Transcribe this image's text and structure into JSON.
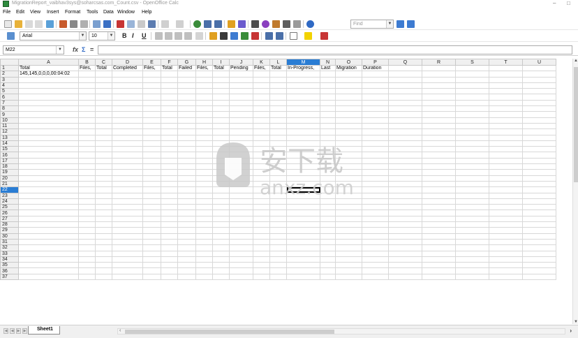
{
  "window": {
    "title": "MigrationReport_vaibhav3sys@soharcsas.com_Count.csv - OpenOffice Calc",
    "minimize": "–",
    "maximize": "□"
  },
  "menu": [
    "File",
    "Edit",
    "View",
    "Insert",
    "Format",
    "Tools",
    "Data",
    "Window",
    "Help"
  ],
  "toolbar": {
    "find_placeholder": "Find",
    "font_name": "Arial",
    "font_size": "10",
    "bold": "B",
    "italic": "I",
    "underline": "U"
  },
  "formula_bar": {
    "cell_ref": "M22",
    "fx": "fx",
    "sum": "Σ",
    "equals": "=",
    "content": ""
  },
  "grid": {
    "columns": [
      "A",
      "B",
      "C",
      "D",
      "E",
      "F",
      "G",
      "H",
      "I",
      "J",
      "K",
      "L",
      "M",
      "N",
      "O",
      "P",
      "Q",
      "R",
      "S",
      "T",
      "U"
    ],
    "selected_column": "M",
    "selected_row": 22,
    "rows": [
      [
        "Total",
        "Files,",
        "Total",
        "Completed",
        "Files,",
        "Total",
        "Failed",
        "Files,",
        "Total",
        "Pending",
        "Files,",
        "Total",
        "In-Progress,",
        "Last",
        "Migration",
        "Duration",
        "",
        "",
        "",
        "",
        ""
      ],
      [
        "145,145,0,0,0,00:04:02",
        "",
        "",
        "",
        "",
        "",
        "",
        "",
        "",
        "",
        "",
        "",
        "",
        "",
        "",
        "",
        "",
        "",
        "",
        "",
        ""
      ]
    ],
    "row_count": 37
  },
  "sheet_tabs": [
    "Sheet1"
  ],
  "watermark": {
    "chinese": "安下载",
    "latin": "anxz.com"
  },
  "colors": {
    "selection": "#2a7dd4",
    "header_bg": "#f0f0f0",
    "gridline": "#d8d8d8"
  }
}
